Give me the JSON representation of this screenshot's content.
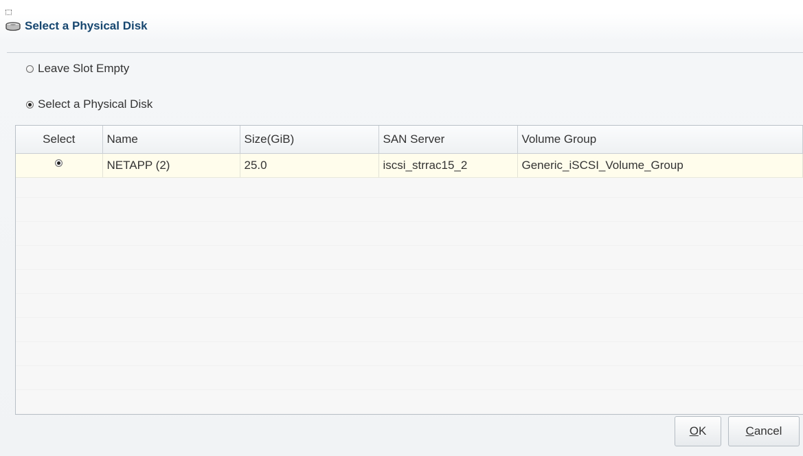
{
  "dialog": {
    "title": "Select a Physical Disk",
    "icon": "disk-icon"
  },
  "options": {
    "leave_empty_label": "Leave Slot Empty",
    "leave_empty_checked": false,
    "select_disk_label": "Select a Physical Disk",
    "select_disk_checked": true
  },
  "table": {
    "columns": [
      "Select",
      "Name",
      "Size(GiB)",
      "SAN Server",
      "Volume Group"
    ],
    "rows": [
      {
        "selected": true,
        "name": "NETAPP (2)",
        "size": "25.0",
        "san_server": "iscsi_strrac15_2",
        "volume_group": "Generic_iSCSI_Volume_Group"
      }
    ]
  },
  "buttons": {
    "ok_mnemonic": "O",
    "ok_rest": "K",
    "cancel_mnemonic": "C",
    "cancel_rest": "ancel"
  },
  "colors": {
    "title": "#16466f",
    "selected_row": "#fffdec",
    "border": "#b9c0c7"
  }
}
